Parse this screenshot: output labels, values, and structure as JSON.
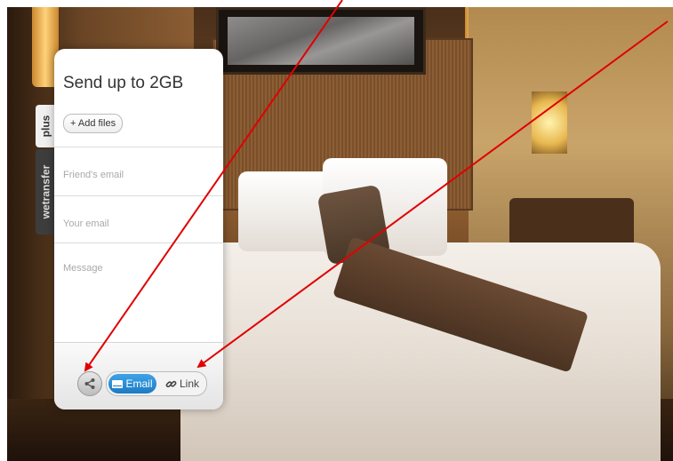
{
  "panel": {
    "title": "Send up to 2GB",
    "add_files_label": "+ Add files",
    "fields": {
      "friend_email_placeholder": "Friend's email",
      "your_email_placeholder": "Your email",
      "message_placeholder": "Message"
    },
    "share_icon": "share-icon",
    "toggle": {
      "email_label": "Email",
      "link_label": "Link",
      "selected": "Email"
    }
  },
  "side_tabs": {
    "plus": "plus",
    "wetransfer": "wetransfer"
  },
  "colors": {
    "accent_blue": "#1b7bc4",
    "arrow_red": "#e00000"
  }
}
